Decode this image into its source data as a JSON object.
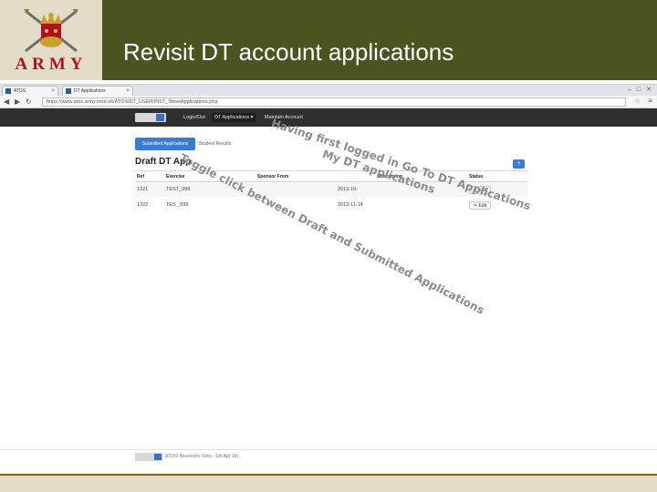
{
  "slide": {
    "title": "Revisit DT account applications",
    "brand": "ARMY"
  },
  "browser": {
    "tabs": [
      {
        "label": "ATOS"
      },
      {
        "label": "DT Applications"
      }
    ],
    "url": "https://www.atos.army.mod.uk/ATOS/DT_USER/INST_ShowApplications.php"
  },
  "app_nav": {
    "items": [
      "Login/Out",
      "DT Applications ▾",
      "Maintain Account"
    ]
  },
  "sub_tabs": {
    "active": "Submitted Applications",
    "other": "Student Results"
  },
  "page": {
    "heading": "Draft DT App",
    "add_label": "+"
  },
  "table": {
    "columns": [
      "Ref",
      "Exercise",
      "Sponsor From",
      "Discerning",
      "Status"
    ],
    "rows": [
      {
        "ref": "1321",
        "exercise": "TEST_999",
        "date": "2013-10-",
        "action": "✎ Edit"
      },
      {
        "ref": "1322",
        "exercise": "TES _999",
        "date": "2013-11-14",
        "action": "✎ Edit"
      }
    ]
  },
  "footer": {
    "text": "ATOS: Assessors View - Sol Apr 1th"
  },
  "annotations": {
    "line1": "Having first logged in Go To DT Applications",
    "line2": "My DT applications",
    "line3": "Toggle click between Draft and Submitted Applications"
  }
}
